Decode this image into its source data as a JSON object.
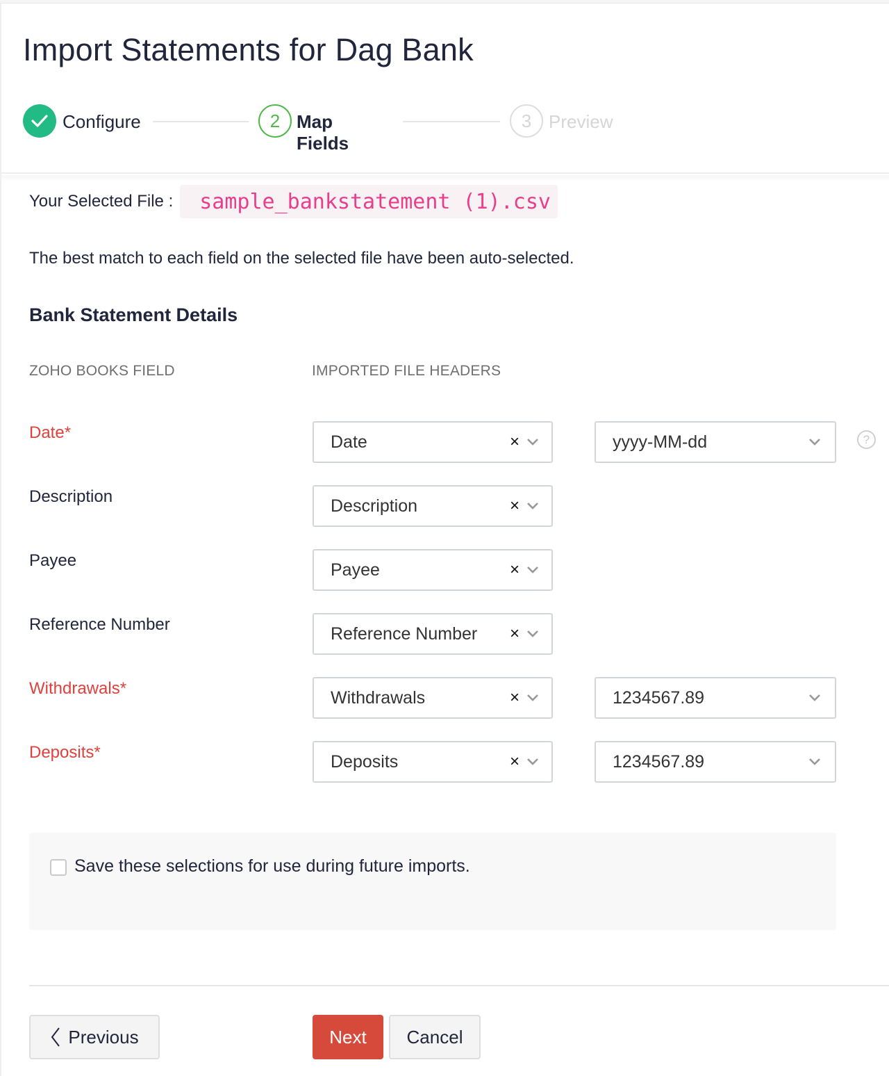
{
  "page": {
    "title": "Import Statements for Dag Bank"
  },
  "stepper": {
    "steps": [
      {
        "number": "1",
        "label": "Configure",
        "state": "completed",
        "icon": "check-icon"
      },
      {
        "number": "2",
        "label": "Map Fields",
        "state": "active"
      },
      {
        "number": "3",
        "label": "Preview",
        "state": "pending"
      }
    ]
  },
  "file": {
    "label": "Your Selected File :",
    "name": "sample_bankstatement (1).csv"
  },
  "info_text": "The best match to each field on the selected file have been auto-selected.",
  "section": {
    "title": "Bank Statement Details",
    "col_zoho": "ZOHO BOOKS FIELD",
    "col_imported": "IMPORTED FILE HEADERS"
  },
  "fields": [
    {
      "label": "Date*",
      "required": true,
      "mapped": "Date",
      "format": "yyyy-MM-dd",
      "has_help": true
    },
    {
      "label": "Description",
      "required": false,
      "mapped": "Description"
    },
    {
      "label": "Payee",
      "required": false,
      "mapped": "Payee"
    },
    {
      "label": "Reference Number",
      "required": false,
      "mapped": "Reference Number"
    },
    {
      "label": "Withdrawals*",
      "required": true,
      "mapped": "Withdrawals",
      "format": "1234567.89"
    },
    {
      "label": "Deposits*",
      "required": true,
      "mapped": "Deposits",
      "format": "1234567.89"
    }
  ],
  "icons": {
    "clear": "×",
    "help": "?"
  },
  "save_option": {
    "label": "Save these selections for use during future imports.",
    "checked": false
  },
  "buttons": {
    "previous": "Previous",
    "next": "Next",
    "cancel": "Cancel"
  },
  "colors": {
    "accent_green": "#23bb85",
    "active_step": "#4fb84a",
    "required_red": "#e0413c",
    "primary_button": "#d64a3b",
    "filename_pink": "#e83e8c"
  }
}
